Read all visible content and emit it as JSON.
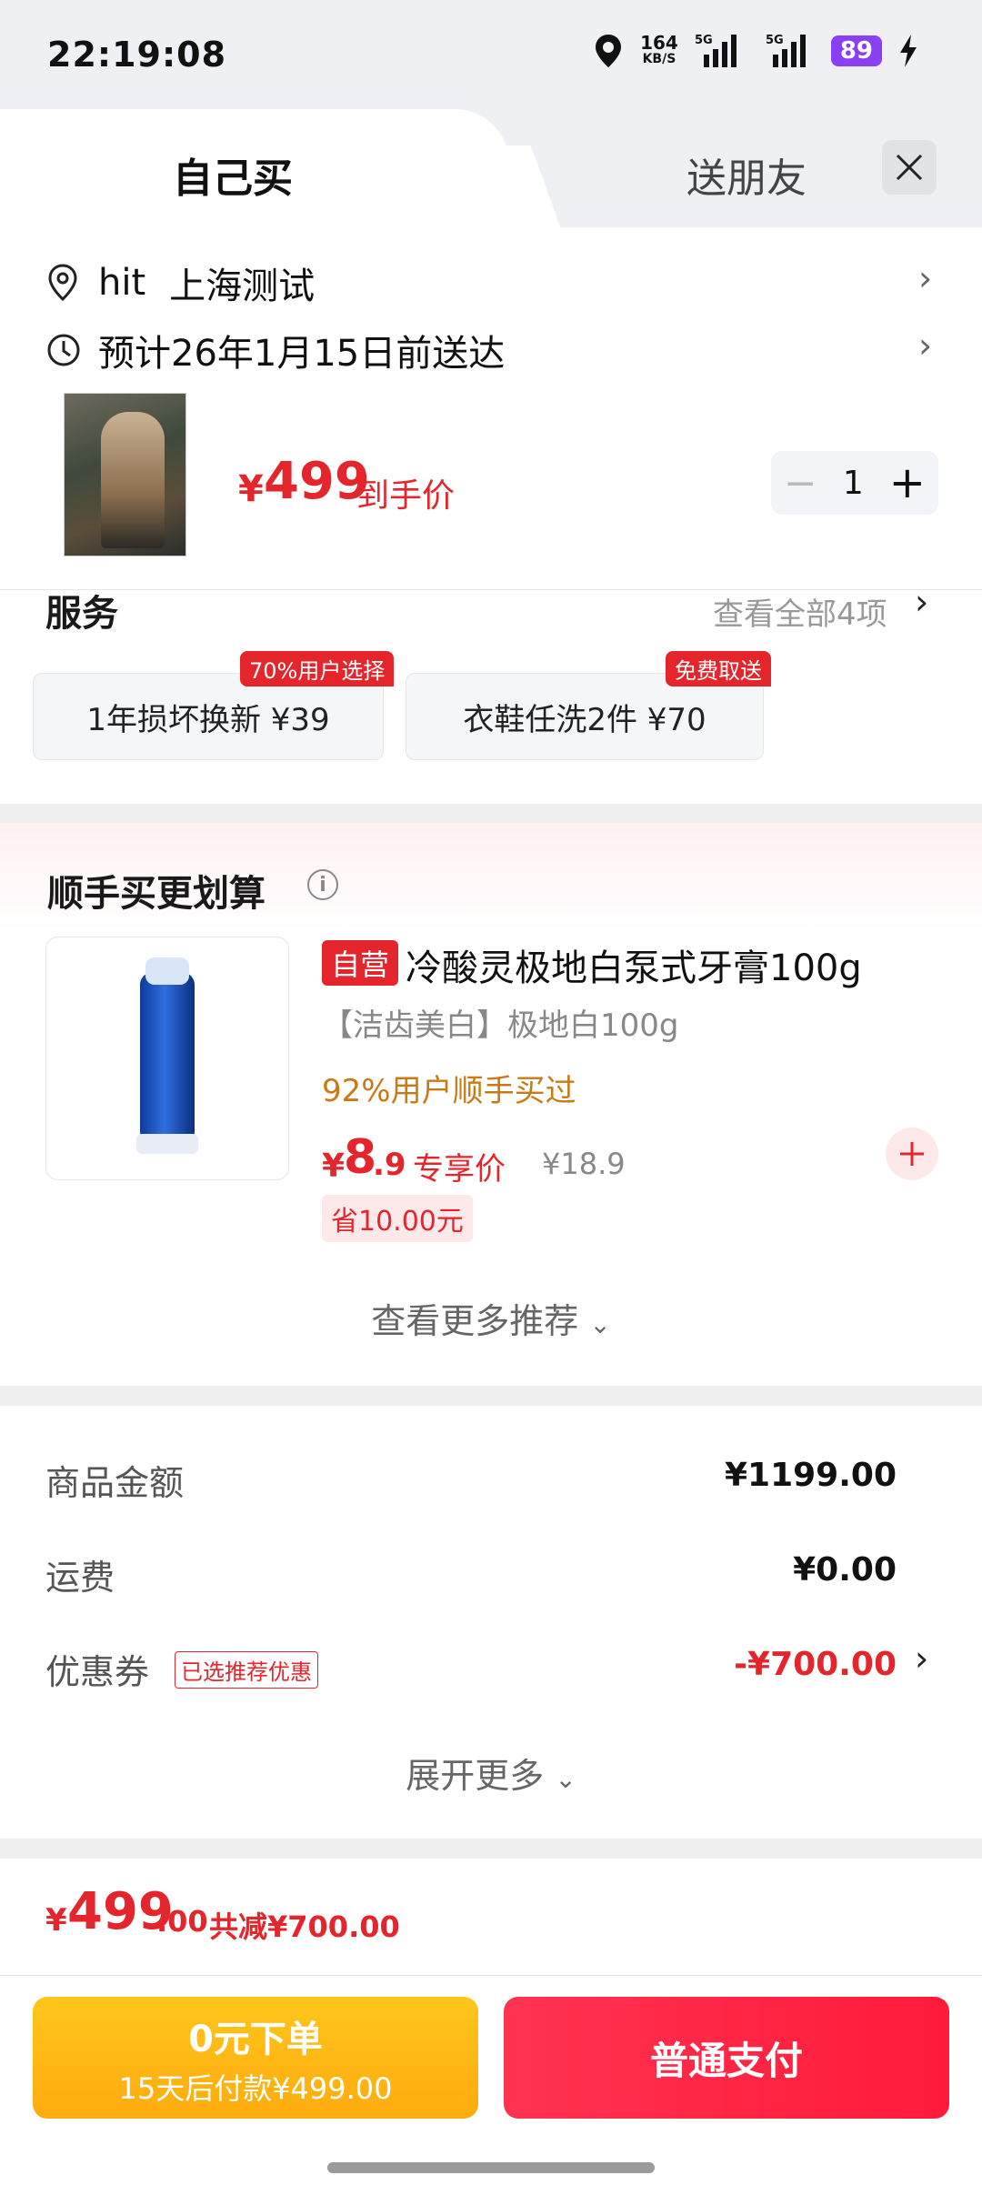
{
  "status_bar": {
    "time": "22:19:08",
    "net_speed": "164",
    "net_unit": "KB/S",
    "signal1": "5G",
    "signal2": "5G",
    "battery": "89"
  },
  "tabs": {
    "self_buy": "自己买",
    "gift": "送朋友"
  },
  "address": {
    "name": "hit",
    "detail": "上海测试"
  },
  "delivery": {
    "text": "预计26年1月15日前送达"
  },
  "product": {
    "price_symbol": "¥",
    "price": "499",
    "price_label": "到手价",
    "quantity": "1"
  },
  "services": {
    "title": "服务",
    "view_all": "查看全部4项",
    "items": [
      {
        "label": "1年损坏换新  ¥39",
        "badge": "70%用户选择"
      },
      {
        "label": "衣鞋任洗2件  ¥70",
        "badge": "免费取送"
      }
    ]
  },
  "addon": {
    "title": "顺手买更划算",
    "tag": "自营",
    "name": "冷酸灵极地白泵式牙膏100g",
    "subtitle": "【洁齿美白】极地白100g",
    "bought": "92%用户顺手买过",
    "price_symbol": "¥",
    "price_int": "8",
    "price_dec": ".9",
    "price_label": "专享价",
    "original_price": "¥18.9",
    "save": "省10.00元",
    "more": "查看更多推荐"
  },
  "summary": {
    "goods_label": "商品金额",
    "goods_value": "¥1199.00",
    "shipping_label": "运费",
    "shipping_value": "¥0.00",
    "coupon_label": "优惠券",
    "coupon_tag": "已选推荐优惠",
    "coupon_value": "-¥700.00",
    "expand": "展开更多"
  },
  "total": {
    "symbol": "¥",
    "int": "499",
    "dec": ".00",
    "save": "共减¥700.00"
  },
  "buttons": {
    "later_line1": "0元下单",
    "later_line2": "15天后付款¥499.00",
    "pay": "普通支付"
  },
  "colors": {
    "accent": "#e4262c",
    "later_button": "#ffb812",
    "pay_button": "#ff2a45"
  }
}
